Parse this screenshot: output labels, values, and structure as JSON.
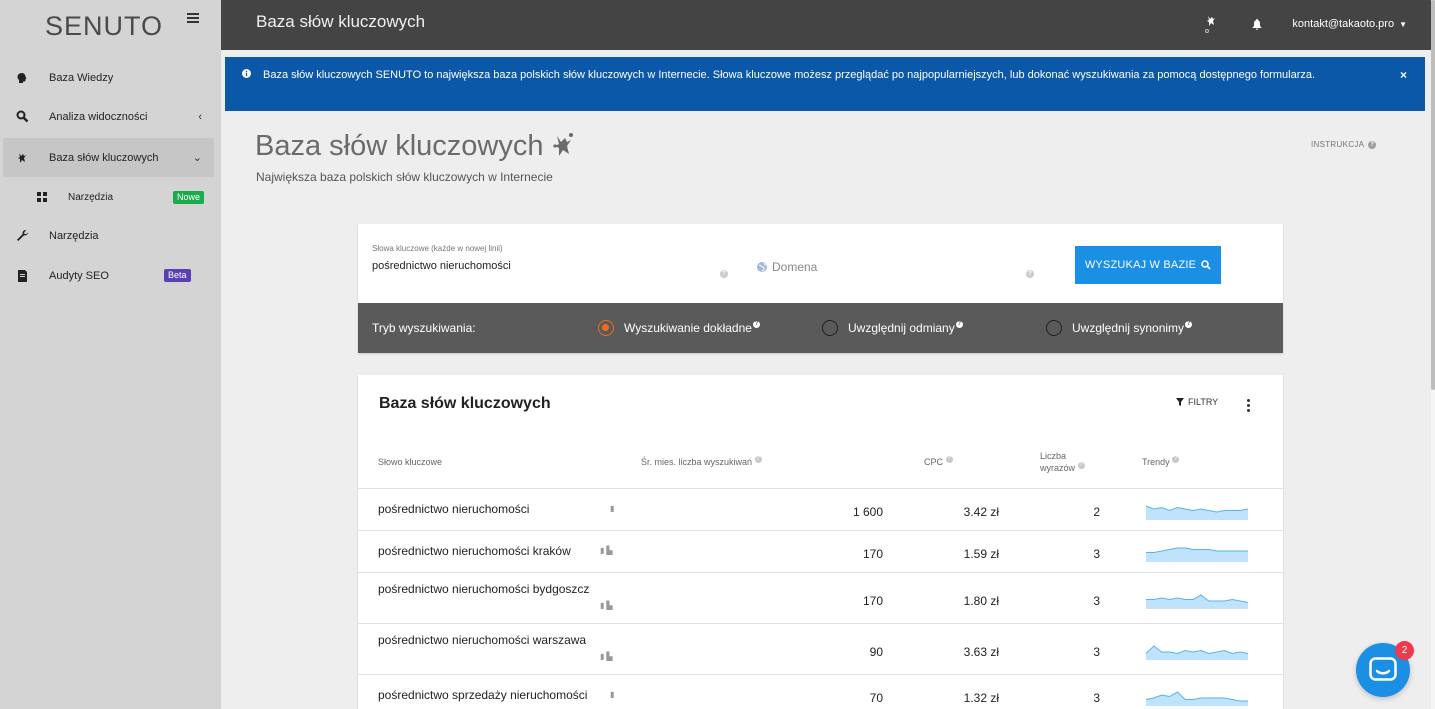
{
  "app": {
    "logo": "SENUTO",
    "page_header_title": "Baza słów kluczowych",
    "user_email": "kontakt@takaoto.pro"
  },
  "sidebar": {
    "items": [
      {
        "label": "Baza Wiedzy",
        "icon": "brain-icon"
      },
      {
        "label": "Analiza widoczności",
        "icon": "search-icon"
      },
      {
        "label": "Baza słów kluczowych",
        "icon": "keyword-base-icon"
      },
      {
        "label": "Narzędzia",
        "icon": "grid-icon",
        "badge": "Nowe"
      },
      {
        "label": "Narzędzia",
        "icon": "wrench-icon"
      },
      {
        "label": "Audyty SEO",
        "icon": "audit-icon",
        "badge": "Beta"
      }
    ]
  },
  "alert": {
    "text": "Baza słów kluczowych SENUTO to największa baza polskich słów kluczowych w Internecie. Słowa kluczowe możesz przeglądać po najpopularniejszych, lub dokonać wyszukiwania za pomocą dostępnego formularza.",
    "close": "×"
  },
  "page": {
    "title": "Baza słów kluczowych",
    "subtitle": "Największa baza polskich słów kluczowych w Internecie",
    "instrukcja": "INSTRUKCJA"
  },
  "search": {
    "keywords_label": "Słowa kluczowe (każde w nowej linii)",
    "keywords_value": "pośrednictwo nieruchomości",
    "domain_placeholder": "Domena",
    "button_label": "WYSZUKAJ W BAZIE",
    "mode_label": "Tryb wyszukiwania:",
    "modes": [
      {
        "label": "Wyszukiwanie dokładne",
        "selected": true
      },
      {
        "label": "Uwzględnij odmiany",
        "selected": false
      },
      {
        "label": "Uwzględnij synonimy",
        "selected": false
      }
    ]
  },
  "results": {
    "title": "Baza słów kluczowych",
    "filters_label": "FILTRY",
    "columns": {
      "keyword": "Słowo kluczowe",
      "searches": "Śr. mies. liczba wyszukiwań",
      "cpc": "CPC",
      "words_line1": "Liczba",
      "words_line2": "wyrazów",
      "trends": "Trendy"
    },
    "rows": [
      {
        "keyword": "pośrednictwo nieruchomości",
        "searches": "1 600",
        "cpc": "3.42 zł",
        "words": "2",
        "trend": [
          8,
          6,
          7,
          5,
          7,
          6,
          5,
          6,
          5,
          4,
          5,
          5,
          5,
          6
        ]
      },
      {
        "keyword": "pośrednictwo nieruchomości kraków",
        "searches": "170",
        "cpc": "1.59 zł",
        "words": "3",
        "trend": [
          5,
          5,
          6,
          7,
          8,
          8,
          7,
          7,
          7,
          6,
          6,
          6,
          6,
          6
        ]
      },
      {
        "keyword": "pośrednictwo nieruchomości bydgoszcz",
        "searches": "170",
        "cpc": "1.80 zł",
        "words": "3",
        "trend": [
          5,
          5,
          6,
          5,
          6,
          5,
          5,
          8,
          4,
          4,
          4,
          5,
          4,
          3
        ]
      },
      {
        "keyword": "pośrednictwo nieruchomości warszawa",
        "searches": "90",
        "cpc": "3.63 zł",
        "words": "3",
        "trend": [
          3,
          8,
          4,
          4,
          3,
          5,
          4,
          5,
          3,
          4,
          5,
          3,
          4,
          3
        ]
      },
      {
        "keyword": "pośrednictwo sprzedaży nieruchomości",
        "searches": "70",
        "cpc": "1.32 zł",
        "words": "3",
        "trend": [
          3,
          4,
          6,
          5,
          8,
          3,
          3,
          4,
          4,
          4,
          4,
          3,
          2,
          2
        ]
      }
    ]
  },
  "chat": {
    "badge": "2"
  },
  "colors": {
    "brand_blue": "#1a8fe3",
    "alert_blue": "#0b57a8",
    "radio_orange": "#f26b1d",
    "topbar": "#444444",
    "sidebar": "#d4d4d4"
  }
}
